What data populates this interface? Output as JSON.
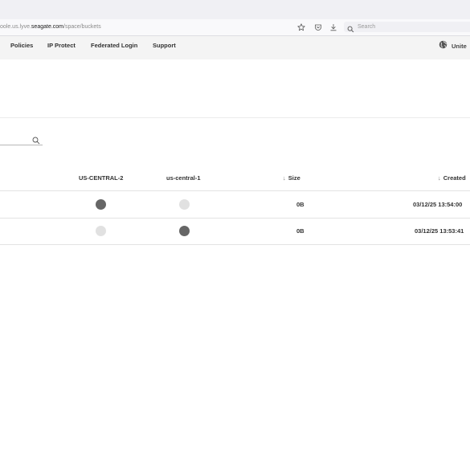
{
  "browser": {
    "url_prefix": "oole.us.lyve.",
    "url_host": "seagate.com",
    "url_path": "/space/buckets",
    "search_placeholder": "Search"
  },
  "nav": {
    "items": [
      "Policies",
      "IP Protect",
      "Federated Login",
      "Support"
    ],
    "region_label": "Unite"
  },
  "table": {
    "headers": {
      "region1": "US-CENTRAL-2",
      "region2": "us-central-1",
      "size": "Size",
      "created": "Created"
    },
    "sort_arrow": "↓",
    "rows": [
      {
        "us_central_2": true,
        "us_central_1": false,
        "size": "0B",
        "created": "03/12/25 13:54:00"
      },
      {
        "us_central_2": false,
        "us_central_1": true,
        "size": "0B",
        "created": "03/12/25 13:53:41"
      }
    ]
  },
  "colors": {
    "dot_active": "#666666",
    "dot_inactive": "#e1e1e1",
    "nav_bg": "#f4f4f4"
  },
  "icons": {
    "browser": [
      "bookmark-star-icon",
      "pocket-icon",
      "download-icon",
      "search-icon"
    ],
    "region": "globe-icon",
    "filter": "search-icon"
  }
}
